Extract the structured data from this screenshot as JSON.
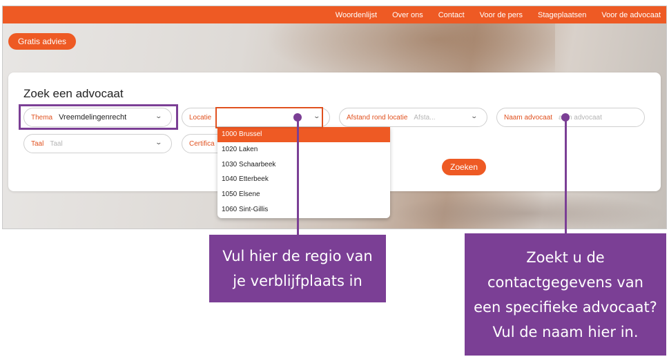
{
  "nav": {
    "items": [
      "Woordenlijst",
      "Over ons",
      "Contact",
      "Voor de pers",
      "Stageplaatsen",
      "Voor de advocaat"
    ]
  },
  "advies_button": "Gratis advies",
  "search": {
    "title": "Zoek een advocaat",
    "thema": {
      "label": "Thema",
      "value": "Vreemdelingenrecht"
    },
    "locatie": {
      "label": "Locatie",
      "value": ""
    },
    "afstand": {
      "label": "Afstand rond locatie",
      "placeholder": "Afsta..."
    },
    "naam": {
      "label": "Naam advocaat",
      "placeholder": "aam advocaat"
    },
    "taal": {
      "label": "Taal",
      "placeholder": "Taal"
    },
    "certificaat": {
      "label": "Certifica"
    },
    "submit": "Zoeken"
  },
  "locatie_options": [
    "1000 Brussel",
    "1020 Laken",
    "1030 Schaarbeek",
    "1040 Etterbeek",
    "1050 Elsene",
    "1060 Sint-Gillis"
  ],
  "callouts": {
    "left": [
      "Vul hier de regio van",
      "je verblijfplaats in"
    ],
    "right": [
      "Zoekt u de",
      "contactgegevens van",
      "een specifieke advocaat?",
      "Vul de naam hier in."
    ]
  },
  "colors": {
    "brand_orange": "#ee5a24",
    "annotation_purple": "#7b3f95"
  },
  "icons": {
    "dropdown": "chevron-down-icon"
  }
}
